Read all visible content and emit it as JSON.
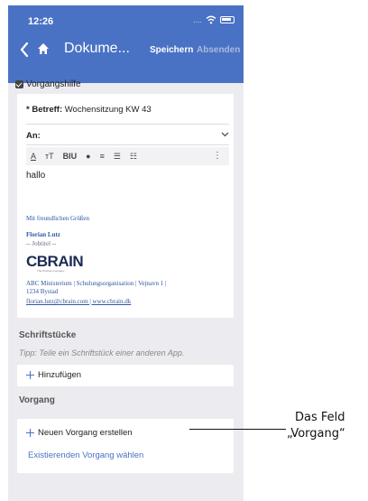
{
  "status": {
    "time": "12:26",
    "signal": "...."
  },
  "nav": {
    "title": "Dokume...",
    "save_label": "Speichern",
    "send_label": "Absenden"
  },
  "help": {
    "label": "Vorgangshilfe",
    "checked": true
  },
  "form": {
    "subject_label": "* Betreff:",
    "subject_value": "Wochensitzung KW 43",
    "to_label": "An:",
    "toolbar": [
      "A",
      "ᴛT",
      "BIU",
      "●",
      "≡",
      "☰",
      "☷",
      "⋮"
    ],
    "body_text": "hallo"
  },
  "signature": {
    "greeting": "Mit freundlichen Grüßen",
    "name": "Florian Lutz",
    "title": "-- Jobtitel --",
    "logo": "CBRAIN",
    "logo_sub": "The Process Company",
    "address_line1": "ABC Ministerium  |  Schulungsorganisation  |  Vejnavn 1  |",
    "address_line2": "1234 Bystad",
    "links": "florian.lutz@cbrain.com  |  www.cbrain.dk"
  },
  "documents": {
    "heading": "Schriftstücke",
    "tip": "Tipp: Teile ein Schriftstück einer anderen App.",
    "add_label": "Hinzufügen"
  },
  "process": {
    "heading": "Vorgang",
    "new_label": "Neuen Vorgang erstellen",
    "existing_label": "Existierenden Vorgang wählen"
  },
  "annotation": {
    "line1": "Das Feld",
    "line2": "„Vorgang“"
  },
  "colors": {
    "accent": "#4a72c4",
    "background": "#ececf0"
  }
}
